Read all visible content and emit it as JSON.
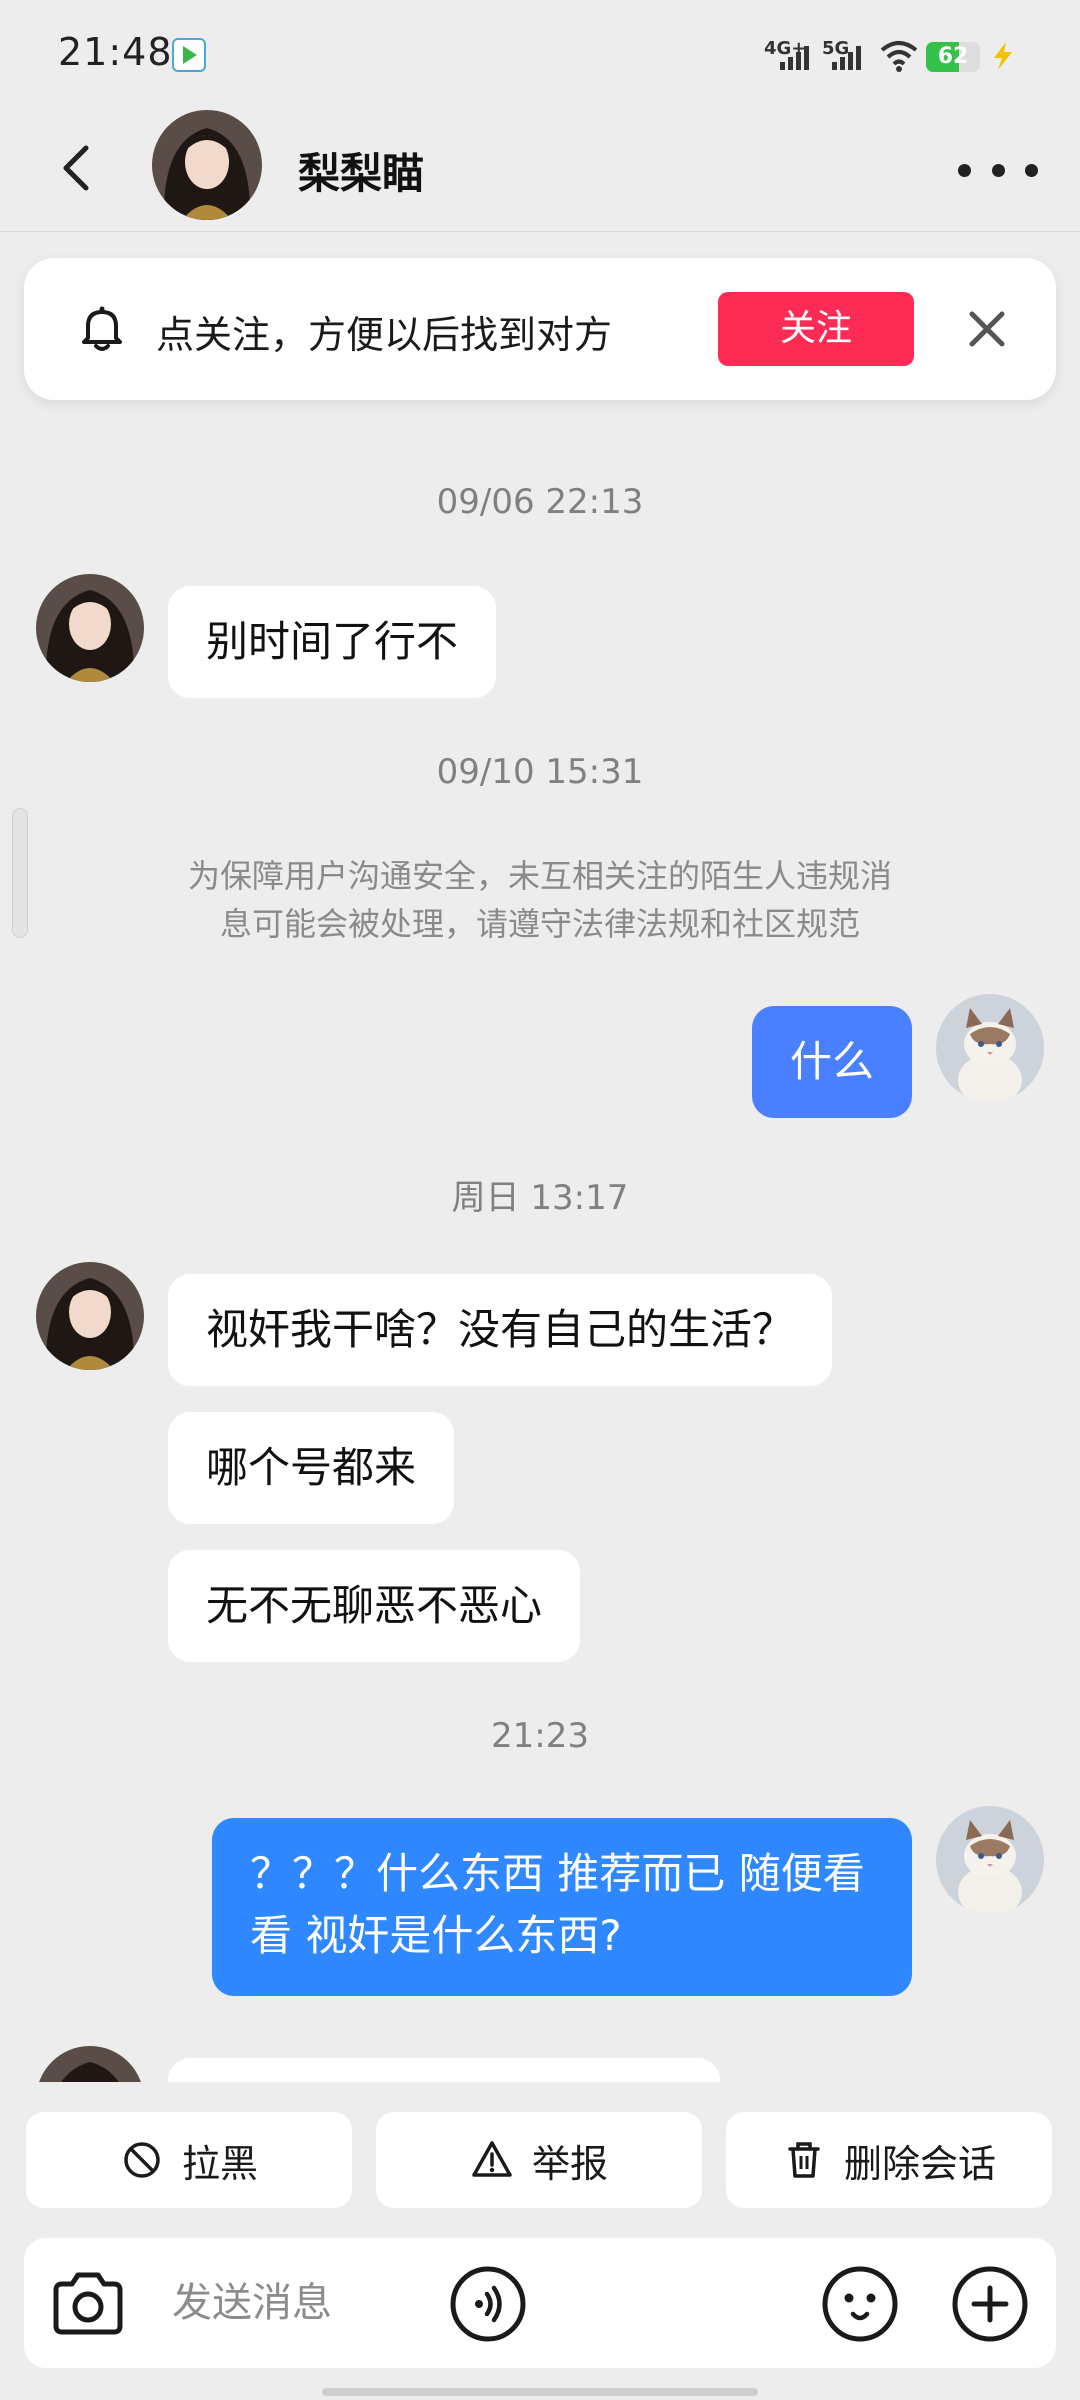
{
  "status_bar": {
    "time": "21:48",
    "network_1": "4G+",
    "network_2": "5G",
    "battery_level": "62"
  },
  "header": {
    "contact_name": "梨梨瞄"
  },
  "follow_banner": {
    "text": "点关注，方便以后找到对方",
    "button_label": "关注"
  },
  "messages": {
    "ts1": "09/06 22:13",
    "m1": "别时间了行不",
    "ts2": "09/10 15:31",
    "notice_line1": "为保障用户沟通安全，未互相关注的陌生人违规消",
    "notice_line2": "息可能会被处理，请遵守法律法规和社区规范",
    "m2": "什么",
    "ts3": "周日 13:17",
    "m3": "视奸我干啥？没有自己的生活？",
    "m4": "哪个号都来",
    "m5": "无不无聊恶不恶心",
    "ts4": "21:23",
    "m6": "？？？什么东西  推荐而已  随便看看 视奸是什么东西?"
  },
  "actions": {
    "block": "拉黑",
    "report": "举报",
    "delete": "删除会话"
  },
  "input": {
    "placeholder": "发送消息"
  },
  "colors": {
    "follow_button": "#fe2c55",
    "outgoing_bubble": "#4a80ff",
    "background": "#ededed"
  }
}
